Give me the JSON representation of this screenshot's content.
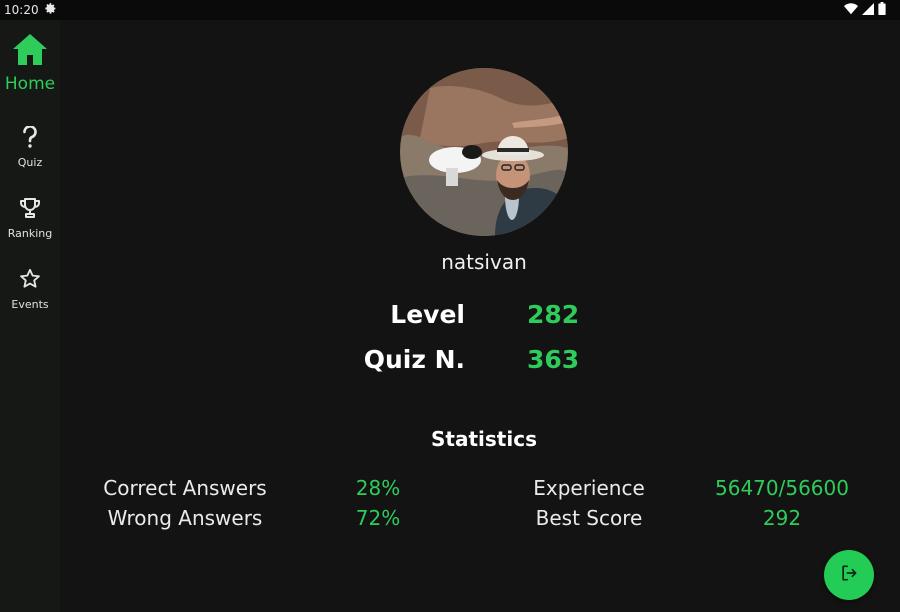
{
  "status_bar": {
    "time": "10:20",
    "icons": [
      "settings-icon",
      "wifi-icon",
      "signal-icon",
      "battery-icon"
    ]
  },
  "nav": {
    "items": [
      {
        "label": "Home",
        "icon": "home-icon",
        "active": true
      },
      {
        "label": "Quiz",
        "icon": "question-icon",
        "active": false
      },
      {
        "label": "Ranking",
        "icon": "trophy-icon",
        "active": false
      },
      {
        "label": "Events",
        "icon": "star-icon",
        "active": false
      }
    ]
  },
  "profile": {
    "username": "natsivan",
    "level_label": "Level",
    "level_value": "282",
    "quiz_label": "Quiz N.",
    "quiz_value": "363"
  },
  "statistics": {
    "title": "Statistics",
    "correct_label": "Correct Answers",
    "correct_value": "28%",
    "wrong_label": "Wrong Answers",
    "wrong_value": "72%",
    "experience_label": "Experience",
    "experience_value": "56470/56600",
    "best_label": "Best Score",
    "best_value": "292"
  },
  "fab": {
    "icon": "logout-icon"
  },
  "colors": {
    "accent": "#2ecc5a",
    "background": "#131313",
    "nav_background": "#161815",
    "fab": "#22cc55"
  }
}
